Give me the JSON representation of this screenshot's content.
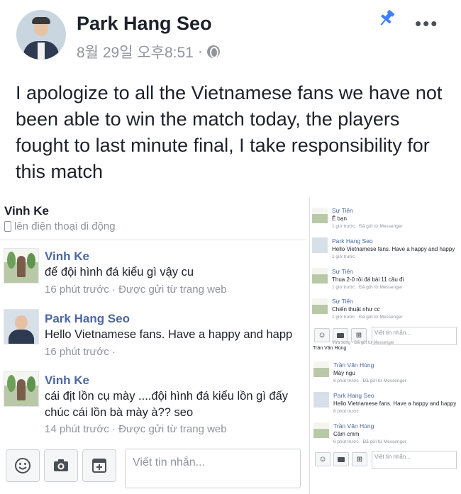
{
  "post": {
    "author": "Park Hang Seo",
    "timestamp": "8월 29일 오후8:51",
    "separator": "·",
    "privacy_icon": "globe-icon",
    "pin_icon": "pin-icon",
    "more_icon": "more-options-icon",
    "more_label": "•••",
    "text": "I apologize to all the Vietnamese fans we have not been able to win the match today, the players fought to last minute final, I take responsibility for this match"
  },
  "chat_left": {
    "contact_name": "Vinh Ke",
    "contact_status": "lên điện thoại di động",
    "messages": [
      {
        "name": "Vinh Ke",
        "text": "để đội hình đá kiểu gì vậy cu",
        "time": "16 phút trước · Được gửi từ trang web"
      },
      {
        "name": "Park Hang Seo",
        "text": "Hello Vietnamese fans. Have a happy and happ",
        "time": "16 phút trước ·"
      },
      {
        "name": "Vinh Ke",
        "text": "cái địt lồn cụ mày ....đội hình đá kiểu lồn gì đấy chúc cái lồn bà mày à?? seo",
        "time": "14 phút trước · Được gửi từ trang web"
      }
    ],
    "input_placeholder": "Viết tin nhắn..."
  },
  "chat_right_top": {
    "messages": [
      {
        "name": "Sự Tiến",
        "text": "Ê bạn",
        "time": "1 giờ trước · Đã gửi từ Messenger"
      },
      {
        "name": "Park Hang Seo",
        "text": "Hello Vietnamese fans. Have a happy and happy",
        "time": "1 giờ trước"
      },
      {
        "name": "Sự Tiến",
        "text": "Thua 2-0 rồi đá bài 11 cầu đi",
        "time": "1 giờ trước · Đã gửi từ Messenger"
      },
      {
        "name": "Sự Tiến",
        "text": "Chiến thuật như cc",
        "time": "1 giờ trước · Đã gửi từ Messenger"
      }
    ],
    "input_placeholder": "Viết tin nhắn...",
    "footer_time": "Vừa xong · Đã gửi từ Messenger"
  },
  "chat_right_bottom": {
    "cut_header": "Trần Văn Hùng",
    "messages": [
      {
        "name": "Trần Văn Hùng",
        "text": "Mày ngu",
        "time": "8 phút trước · Đã gửi từ Messenger"
      },
      {
        "name": "Park Hang Seo",
        "text": "Hello Vietnamese fans. Have a happy and happy",
        "time": "8 phút trước"
      },
      {
        "name": "Trần Văn Hùng",
        "text": "Câm cmm",
        "time": "8 phút trước · Đã gửi từ Messenger"
      }
    ],
    "input_placeholder": "Viết tin nhắn..."
  },
  "toolbar_icons": [
    "emoji-icon",
    "camera-icon",
    "sticker-icon"
  ],
  "colors": {
    "link_blue": "#4b67a1",
    "pin_blue": "#4080ff",
    "meta_gray": "#90949c"
  }
}
